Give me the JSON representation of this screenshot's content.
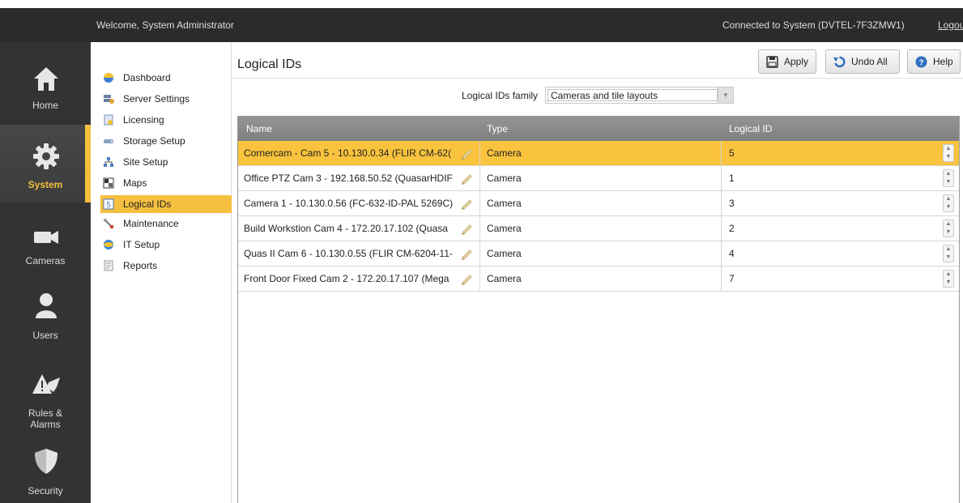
{
  "topbar": {
    "welcome": "Welcome, System Administrator",
    "connection": "Connected to System (DVTEL-7F3ZMW1)",
    "logout": "Logout"
  },
  "rail": [
    {
      "label": "Home",
      "icon": "home-icon"
    },
    {
      "label": "System",
      "icon": "gear-icon",
      "active": true
    },
    {
      "label": "Cameras",
      "icon": "camera-icon"
    },
    {
      "label": "Users",
      "icon": "user-icon"
    },
    {
      "label": "Rules &",
      "label2": "Alarms",
      "icon": "alarm-icon"
    },
    {
      "label": "Security",
      "icon": "shield-icon"
    }
  ],
  "nav": [
    {
      "label": "Dashboard",
      "icon": "dashboard-icon"
    },
    {
      "label": "Server Settings",
      "icon": "server-icon"
    },
    {
      "label": "Licensing",
      "icon": "license-icon"
    },
    {
      "label": "Storage Setup",
      "icon": "storage-icon"
    },
    {
      "label": "Site Setup",
      "icon": "site-icon"
    },
    {
      "label": "Maps",
      "icon": "map-icon"
    },
    {
      "label": "Logical IDs",
      "icon": "logical-id-icon",
      "active": true
    },
    {
      "label": "Maintenance",
      "icon": "wrench-icon"
    },
    {
      "label": "IT Setup",
      "icon": "it-icon"
    },
    {
      "label": "Reports",
      "icon": "report-icon"
    }
  ],
  "main": {
    "title": "Logical IDs",
    "buttons": {
      "apply": "Apply",
      "undo_all": "Undo All",
      "help": "Help"
    },
    "family_label": "Logical IDs family",
    "family_value": "Cameras and tile layouts",
    "columns": {
      "name": "Name",
      "type": "Type",
      "logical_id": "Logical ID"
    },
    "rows": [
      {
        "name": "Cornercam - Cam 5 - 10.130.0.34 (FLIR CM-62(",
        "type": "Camera",
        "id": "5",
        "selected": true
      },
      {
        "name": "Office PTZ Cam 3 - 192.168.50.52 (QuasarHDIF",
        "type": "Camera",
        "id": "1"
      },
      {
        "name": "Camera 1 - 10.130.0.56 (FC-632-ID-PAL 5269C)",
        "type": "Camera",
        "id": "3"
      },
      {
        "name": "Build Workstion Cam 4 - 172.20.17.102 (Quasa",
        "type": "Camera",
        "id": "2"
      },
      {
        "name": "Quas II Cam 6 - 10.130.0.55 (FLIR CM-6204-11-",
        "type": "Camera",
        "id": "4"
      },
      {
        "name": "Front Door Fixed Cam 2 - 172.20.17.107 (Mega",
        "type": "Camera",
        "id": "7"
      }
    ]
  },
  "colors": {
    "accent": "#f5bf3f",
    "rail_bg": "#333333",
    "header_bg": "#8a8a8a"
  }
}
